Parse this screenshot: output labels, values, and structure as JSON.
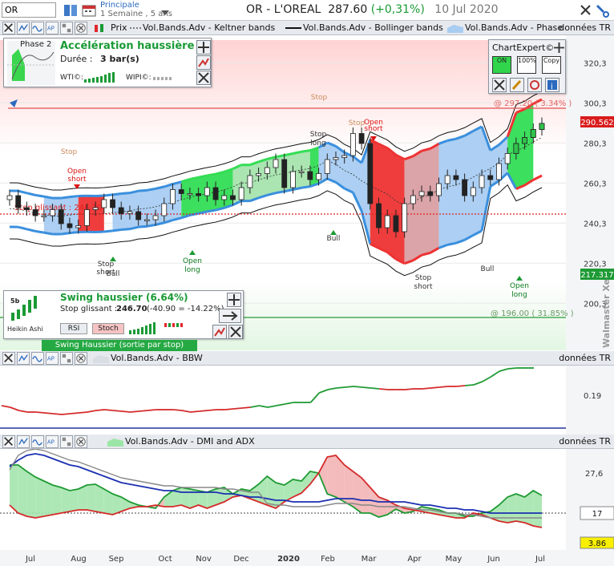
{
  "header": {
    "symbol": "OR",
    "period_main": "Principale",
    "period_sub": "1 Semaine , 5 ans",
    "title": "OR - L'OREAL",
    "price": "287.60",
    "change": "(+0,31%)",
    "date": "10 Jul 2020"
  },
  "toolbar_main": {
    "prix": "Prix",
    "keltner": "Vol.Bands.Adv - Keltner bands",
    "bollinger": "Vol.Bands.Adv - Bollinger bands",
    "phase": "Vol.Bands.Adv - Phase",
    "donnees": "données TR"
  },
  "phase_box": {
    "phase_label": "Phase 2",
    "title": "Accélération haussière",
    "duration_label": "Durée :",
    "duration_value": "3 bar(s)",
    "wti_label": "WTI©:",
    "wipi_label": "WIPI©:"
  },
  "chartexpert": {
    "title": "ChartExpert©",
    "btn_on": "ON",
    "btn_100": "100%",
    "btn_copy": "Copy"
  },
  "swing_box": {
    "title": "Swing haussier (6.64%)",
    "stop_label": "Stop glissant :",
    "stop_value": "246.70",
    "stop_delta": "(-40.90 = -14.22%)",
    "rsi": "RSI",
    "stoch": "Stoch",
    "heikin": "Heikin Ashi",
    "tf": "5b",
    "bar": "Swing Haussier (sortie par stop)"
  },
  "main_chart": {
    "y_ticks": [
      "320,3",
      "300,3",
      "280,3",
      "260,3",
      "240,3",
      "220,3",
      "200,3"
    ],
    "target_label": "@ 297.20 ( 3.34% )",
    "support_label": "@ 196.00 ( 31.85% )",
    "stop_dotted_label": "Stop glissant : 246.70",
    "price_badge": "290.562",
    "lower_badge": "217.317",
    "vertical_brand": "Walmaster Xe",
    "annotations": {
      "stop": "Stop",
      "open": "Open",
      "short": "short",
      "long": "long",
      "bull": "Bull"
    }
  },
  "bbw_pane": {
    "label": "Vol.Bands.Adv - BBW",
    "donnees": "données TR",
    "tick": "0.19"
  },
  "dmi_pane": {
    "label": "Vol.Bands.Adv - DMI and ADX",
    "donnees": "données TR",
    "tick": "27,6",
    "badge_17": "17",
    "badge_386": "3.86"
  },
  "x_axis": [
    "Jul",
    "Aug",
    "Sep",
    "Oct",
    "Nov",
    "Dec",
    "2020",
    "Feb",
    "Mar",
    "Apr",
    "May",
    "Jun",
    "Jul"
  ],
  "chart_data": {
    "type": "candlestick",
    "price_panel": {
      "ylim": [
        190,
        330
      ],
      "candles_close": [
        254,
        248,
        247,
        244,
        244,
        247,
        240,
        238,
        239,
        247,
        248,
        252,
        248,
        245,
        246,
        242,
        242,
        244,
        250,
        257,
        255,
        255,
        254,
        258,
        252,
        254,
        252,
        258,
        264,
        265,
        268,
        272,
        258,
        266,
        266,
        262,
        265,
        272,
        273,
        274,
        285,
        280,
        250,
        238,
        244,
        236,
        250,
        254,
        256,
        254,
        260,
        264,
        262,
        254,
        258,
        264,
        262,
        270,
        275,
        280,
        283,
        287,
        290
      ]
    },
    "colors": {
      "accent_blue": "#2a6abf",
      "up_green": "#1a9a35",
      "down_red": "#e0282a",
      "band_green": "#33dd55",
      "band_red": "#ee3333",
      "band_blue": "#a8ccf2"
    }
  }
}
